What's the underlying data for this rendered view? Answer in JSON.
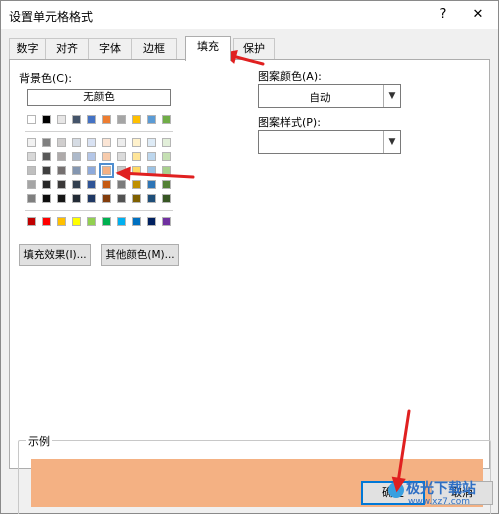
{
  "window": {
    "title": "设置单元格格式",
    "help": "?",
    "close": "✕"
  },
  "tabs": [
    {
      "label": "数字",
      "active": false
    },
    {
      "label": "对齐",
      "active": false
    },
    {
      "label": "字体",
      "active": false
    },
    {
      "label": "边框",
      "active": false
    },
    {
      "label": "填充",
      "active": true
    },
    {
      "label": "保护",
      "active": false
    }
  ],
  "fill": {
    "bg_label": "背景色(C):",
    "no_color": "无颜色",
    "pattern_color_label": "图案颜色(A):",
    "pattern_color_value": "自动",
    "pattern_style_label": "图案样式(P):",
    "pattern_style_value": "",
    "fill_effects": "填充效果(I)...",
    "more_colors": "其他颜色(M)...",
    "theme_top": [
      "#ffffff",
      "#000000",
      "#e7e6e6",
      "#44546a",
      "#4472c4",
      "#ed7d31",
      "#a5a5a5",
      "#ffc000",
      "#5b9bd5",
      "#70ad47"
    ],
    "theme_shades": [
      [
        "#f2f2f2",
        "#808080",
        "#d0cece",
        "#d6dce4",
        "#d9e2f3",
        "#fbe5d5",
        "#ededed",
        "#fff2cc",
        "#deebf6",
        "#e2efd9"
      ],
      [
        "#d8d8d8",
        "#595959",
        "#aeaaaa",
        "#adb9ca",
        "#b4c6e7",
        "#f7cbac",
        "#dbdbdb",
        "#fee599",
        "#bdd7ee",
        "#c5e0b3"
      ],
      [
        "#bfbfbf",
        "#3f3f3f",
        "#757070",
        "#8496b0",
        "#8eaadb",
        "#f4b183",
        "#c9c9c9",
        "#ffd965",
        "#9cc3e5",
        "#a8d08d"
      ],
      [
        "#a5a5a5",
        "#262626",
        "#3a3838",
        "#323f4f",
        "#2f5496",
        "#c55a11",
        "#7b7b7b",
        "#bf9000",
        "#2e75b5",
        "#538135"
      ],
      [
        "#7f7f7f",
        "#0d0d0d",
        "#161616",
        "#222a35",
        "#1f3864",
        "#833c0b",
        "#525252",
        "#7f6000",
        "#1e4e79",
        "#375623"
      ]
    ],
    "standard": [
      "#c00000",
      "#ff0000",
      "#ffc000",
      "#ffff00",
      "#92d050",
      "#00b050",
      "#00b0f0",
      "#0070c0",
      "#002060",
      "#7030a0"
    ],
    "selected_color": "#f4b183"
  },
  "sample": {
    "label": "示例",
    "color": "#f4b183"
  },
  "buttons": {
    "ok": "确定",
    "cancel": "取消"
  },
  "watermark": {
    "name": "极光下载站",
    "url": "www.xz7.com"
  },
  "annotation_color": "#e02020"
}
